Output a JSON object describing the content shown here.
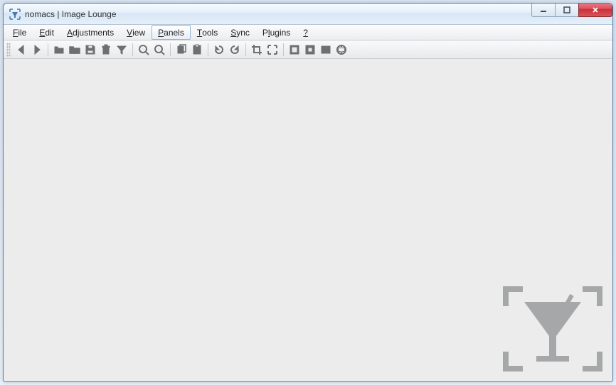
{
  "window": {
    "title": "nomacs | Image Lounge"
  },
  "menu": {
    "items": [
      {
        "label": "File",
        "accel": "F",
        "active": false
      },
      {
        "label": "Edit",
        "accel": "E",
        "active": false
      },
      {
        "label": "Adjustments",
        "accel": "A",
        "active": false
      },
      {
        "label": "View",
        "accel": "V",
        "active": false
      },
      {
        "label": "Panels",
        "accel": "P",
        "active": true
      },
      {
        "label": "Tools",
        "accel": "T",
        "active": false
      },
      {
        "label": "Sync",
        "accel": "S",
        "active": false
      },
      {
        "label": "Plugins",
        "accel": "l",
        "active": false
      },
      {
        "label": "?",
        "accel": "?",
        "active": false
      }
    ]
  },
  "toolbar": {
    "groups": [
      [
        "previous",
        "next"
      ],
      [
        "open-file",
        "open-folder",
        "save",
        "delete",
        "filter"
      ],
      [
        "zoom-in",
        "zoom-out"
      ],
      [
        "copy",
        "paste"
      ],
      [
        "rotate-ccw",
        "rotate-cw"
      ],
      [
        "crop",
        "fullscreen"
      ],
      [
        "fit-window",
        "fit-100",
        "actual-size",
        "gps"
      ]
    ]
  }
}
